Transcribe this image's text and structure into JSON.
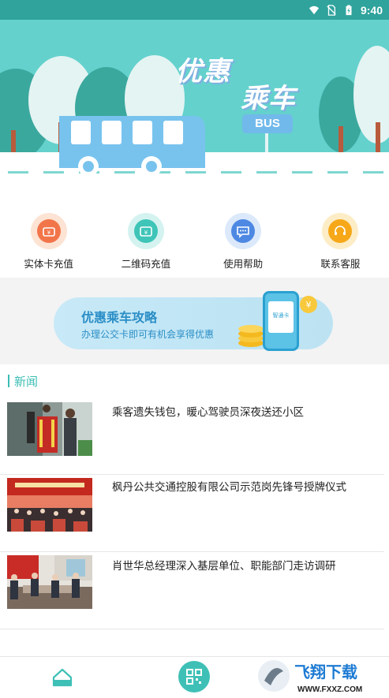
{
  "status_bar": {
    "time": "9:40"
  },
  "banner": {
    "title_line1": "优惠",
    "title_line2": "乘车",
    "bus_sign": "BUS"
  },
  "actions": [
    {
      "label": "实体卡充值",
      "icon": "card-recharge-icon",
      "outer": "#fde3d3",
      "inner": "#f2754a"
    },
    {
      "label": "二维码充值",
      "icon": "qr-recharge-icon",
      "outer": "#d4f3f0",
      "inner": "#3fc5b8"
    },
    {
      "label": "使用帮助",
      "icon": "help-chat-icon",
      "outer": "#dbe9fb",
      "inner": "#4d88e3"
    },
    {
      "label": "联系客服",
      "icon": "headset-icon",
      "outer": "#fdedc7",
      "inner": "#f6a818"
    }
  ],
  "promo": {
    "title": "优惠乘车攻略",
    "subtitle": "办理公交卡即可有机会享得优惠",
    "card_text": "智通卡"
  },
  "news": {
    "header": "新闻",
    "items": [
      {
        "headline": "乘客遗失钱包，暖心驾驶员深夜送还小区"
      },
      {
        "headline": "枫丹公共交通控股有限公司示范岗先锋号授牌仪式"
      },
      {
        "headline": "肖世华总经理深入基层单位、职能部门走访调研"
      }
    ]
  },
  "watermark": {
    "brand": "飞翔下载",
    "url": "WWW.FXXZ.COM"
  },
  "colors": {
    "accent": "#3bbdb4",
    "status_bar": "#2fa39c",
    "banner_bg": "#64d1cd"
  }
}
